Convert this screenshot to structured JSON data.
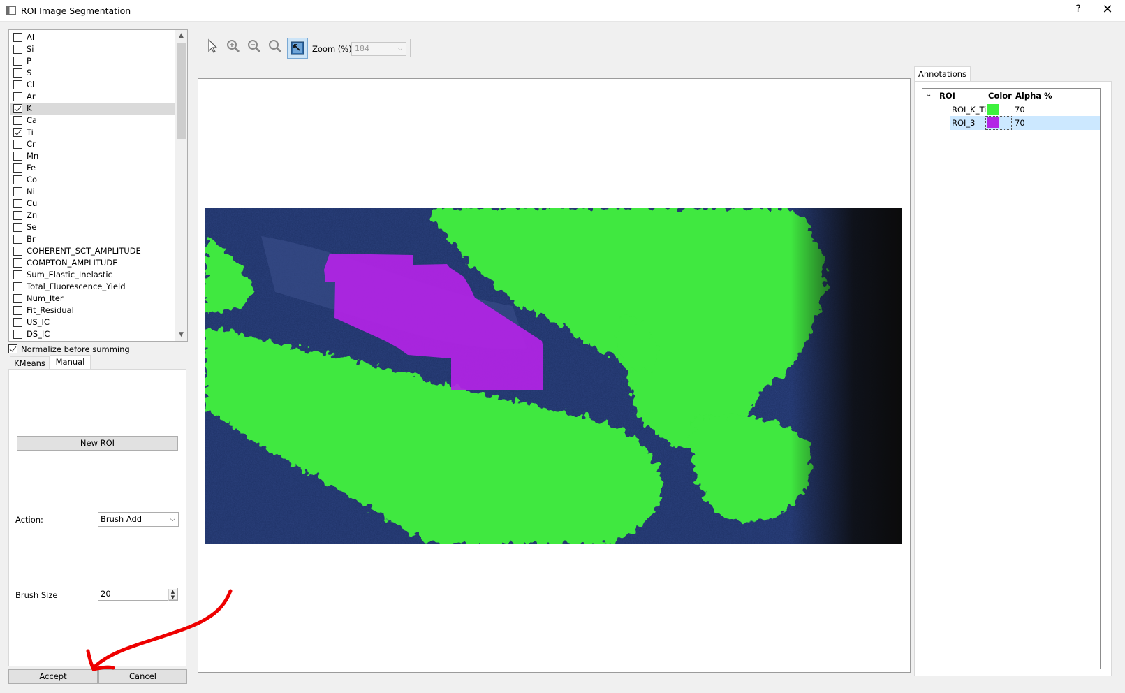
{
  "window": {
    "title": "ROI Image Segmentation",
    "help": "?",
    "close": "✕"
  },
  "elements": [
    {
      "label": "Al",
      "checked": false
    },
    {
      "label": "Si",
      "checked": false
    },
    {
      "label": "P",
      "checked": false
    },
    {
      "label": "S",
      "checked": false
    },
    {
      "label": "Cl",
      "checked": false
    },
    {
      "label": "Ar",
      "checked": false
    },
    {
      "label": "K",
      "checked": true,
      "selected": true
    },
    {
      "label": "Ca",
      "checked": false
    },
    {
      "label": "Ti",
      "checked": true
    },
    {
      "label": "Cr",
      "checked": false
    },
    {
      "label": "Mn",
      "checked": false
    },
    {
      "label": "Fe",
      "checked": false
    },
    {
      "label": "Co",
      "checked": false
    },
    {
      "label": "Ni",
      "checked": false
    },
    {
      "label": "Cu",
      "checked": false
    },
    {
      "label": "Zn",
      "checked": false
    },
    {
      "label": "Se",
      "checked": false
    },
    {
      "label": "Br",
      "checked": false
    },
    {
      "label": "COHERENT_SCT_AMPLITUDE",
      "checked": false
    },
    {
      "label": "COMPTON_AMPLITUDE",
      "checked": false
    },
    {
      "label": "Sum_Elastic_Inelastic",
      "checked": false
    },
    {
      "label": "Total_Fluorescence_Yield",
      "checked": false
    },
    {
      "label": "Num_Iter",
      "checked": false
    },
    {
      "label": "Fit_Residual",
      "checked": false
    },
    {
      "label": "US_IC",
      "checked": false
    },
    {
      "label": "DS_IC",
      "checked": false
    }
  ],
  "normalize": {
    "label": "Normalize before summing",
    "checked": true
  },
  "tabs": {
    "kmeans": "KMeans",
    "manual": "Manual",
    "active": "Manual"
  },
  "manual": {
    "new_roi": "New ROI",
    "action_label": "Action:",
    "action_value": "Brush Add",
    "brush_size_label": "Brush Size",
    "brush_size_value": "20"
  },
  "buttons": {
    "accept": "Accept",
    "cancel": "Cancel"
  },
  "toolbar": {
    "tools": [
      "pointer-icon",
      "zoom-in-icon",
      "zoom-out-icon",
      "zoom-reset-icon",
      "fit-view-icon"
    ],
    "active_tool": "fit-view-icon",
    "zoom_label": "Zoom (%) :",
    "zoom_value": "184"
  },
  "annotations": {
    "tab": "Annotations",
    "columns": {
      "root": "ROI",
      "color": "Color",
      "alpha": "Alpha %"
    },
    "rois": [
      {
        "name": "ROI_K_Ti",
        "color": "#3df23d",
        "alpha": "70"
      },
      {
        "name": "ROI_3",
        "color": "#b324e6",
        "alpha": "70",
        "selected": true
      }
    ]
  },
  "colors": {
    "roi_green": "#3df23d",
    "roi_purple": "#b324e6",
    "map_background": "#1c2f63",
    "annotation_arrow": "#ee0000"
  }
}
